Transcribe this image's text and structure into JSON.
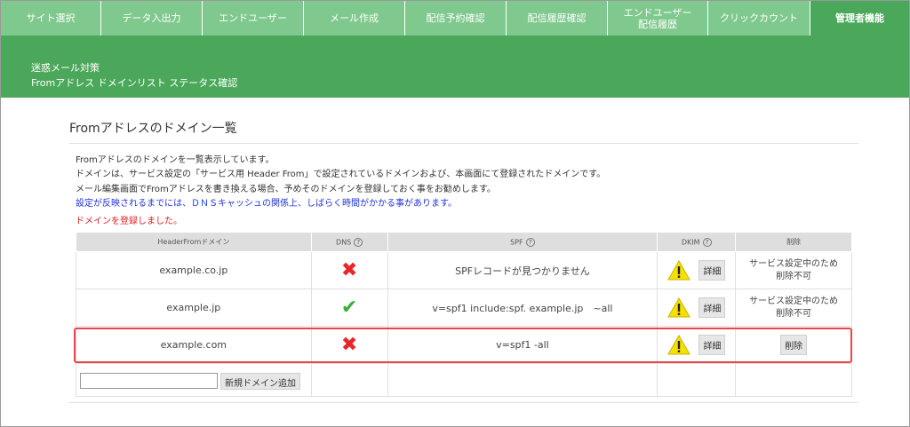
{
  "nav": {
    "items": [
      {
        "label": "サイト選択"
      },
      {
        "label": "データ入出力"
      },
      {
        "label": "エンドユーザー"
      },
      {
        "label": "メール作成"
      },
      {
        "label": "配信予約確認"
      },
      {
        "label": "配信履歴確認"
      },
      {
        "label": "エンドユーザー\n配信履歴"
      },
      {
        "label": "クリックカウント"
      },
      {
        "label": "管理者機能"
      }
    ],
    "active_index": 8
  },
  "header": {
    "line1": "迷惑メール対策",
    "line2": "Fromアドレス ドメインリスト ステータス確認"
  },
  "section": {
    "title": "Fromアドレスのドメイン一覧",
    "desc1": "Fromアドレスのドメインを一覧表示しています。",
    "desc2": "ドメインは、サービス設定の「サービス用 Header From」で設定されているドメインおよび、本画面にて登録されたドメインです。",
    "desc3": "メール編集画面でFromアドレスを書き換える場合、予めそのドメインを登録しておく事をお勧めします。",
    "notice": "設定が反映されるまでには、ＤＮＳキャッシュの関係上、しばらく時間がかかる事があります。",
    "success": "ドメインを登録しました。"
  },
  "table": {
    "headers": {
      "domain": "HeaderFromドメイン",
      "dns": "DNS",
      "spf": "SPF",
      "dkim": "DKIM",
      "delete": "削除"
    },
    "help_glyph": "?",
    "rows": [
      {
        "domain": "example.co.jp",
        "dns_status": "ng",
        "dns_icon": "x-icon",
        "spf": "SPFレコードが見つかりません",
        "dkim_icon": "warning-icon",
        "detail": "詳細",
        "delete_text": "サービス設定中のため\n削除不可",
        "deletable": false
      },
      {
        "domain": "example.jp",
        "dns_status": "ok",
        "dns_icon": "check-icon",
        "spf": "v=spf1 include:spf. example.jp　~all",
        "dkim_icon": "warning-icon",
        "detail": "詳細",
        "delete_text": "サービス設定中のため\n削除不可",
        "deletable": false
      },
      {
        "domain": "example.com",
        "dns_status": "ng",
        "dns_icon": "x-icon",
        "spf": "v=spf1 -all",
        "dkim_icon": "warning-icon",
        "detail": "詳細",
        "delete_text": "削除",
        "deletable": true
      }
    ],
    "new_domain": {
      "value": "",
      "placeholder": "",
      "button": "新規ドメイン追加"
    }
  },
  "colors": {
    "nav_bg": "#7fc98e",
    "header_bg": "#4ba85a",
    "ng": "#e8262a",
    "ok": "#3cae3c",
    "warning": "#f5e000",
    "highlight": "#e9454a",
    "notice_blue": "#2233dd",
    "success_red": "#e02020"
  }
}
